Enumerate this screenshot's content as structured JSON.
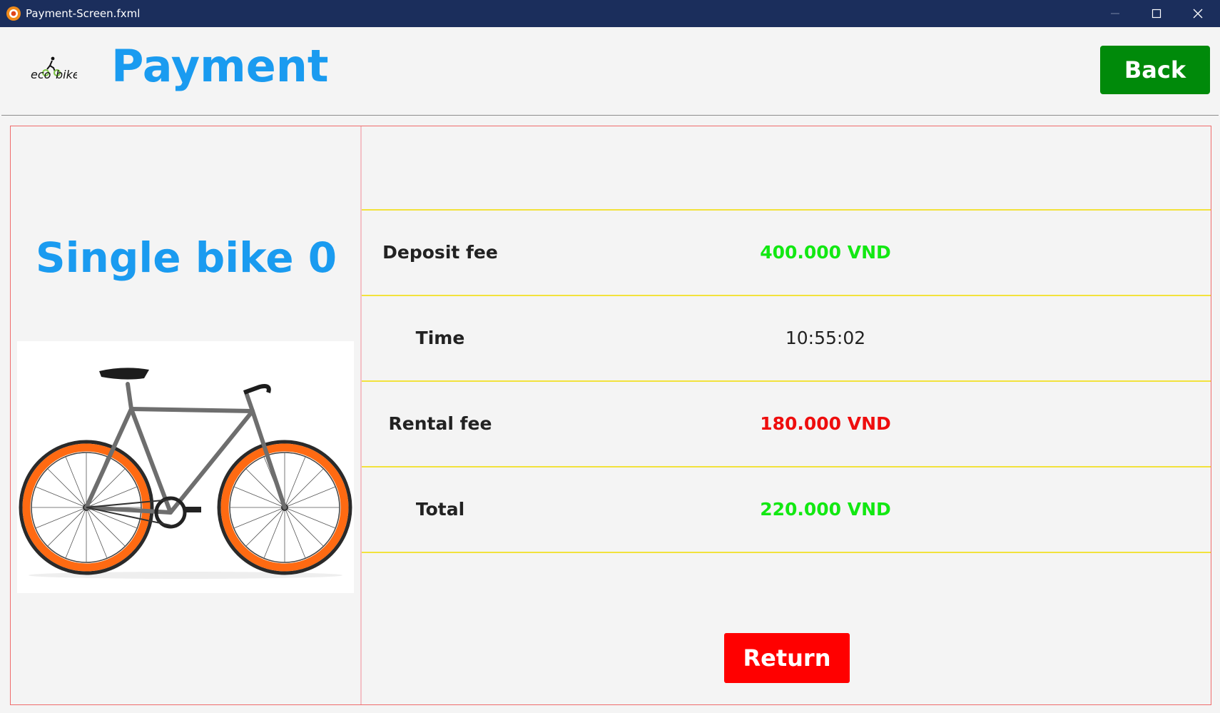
{
  "window": {
    "title": "Payment-Screen.fxml",
    "icon": "app-icon"
  },
  "header": {
    "logo_text": "ecobike",
    "title": "Payment",
    "back_label": "Back"
  },
  "bike": {
    "name": "Single bike 0",
    "image": "bicycle-image"
  },
  "fees": [
    {
      "label": "Deposit fee",
      "value": "400.000 VND",
      "color": "#12e812",
      "bold": true
    },
    {
      "label": "Time",
      "value": "10:55:02",
      "color": "#222222",
      "bold": false
    },
    {
      "label": "Rental fee",
      "value": "180.000 VND",
      "color": "#ee0d0d",
      "bold": true
    },
    {
      "label": "Total",
      "value": "220.000 VND",
      "color": "#12e812",
      "bold": true
    }
  ],
  "actions": {
    "return_label": "Return"
  },
  "colors": {
    "title_bar": "#1b2e5c",
    "accent_blue": "#1a9bf0",
    "back_green": "#008a0a",
    "return_red": "#ff0000",
    "panel_border": "#ef6b6b",
    "row_border": "#f2e23c"
  }
}
